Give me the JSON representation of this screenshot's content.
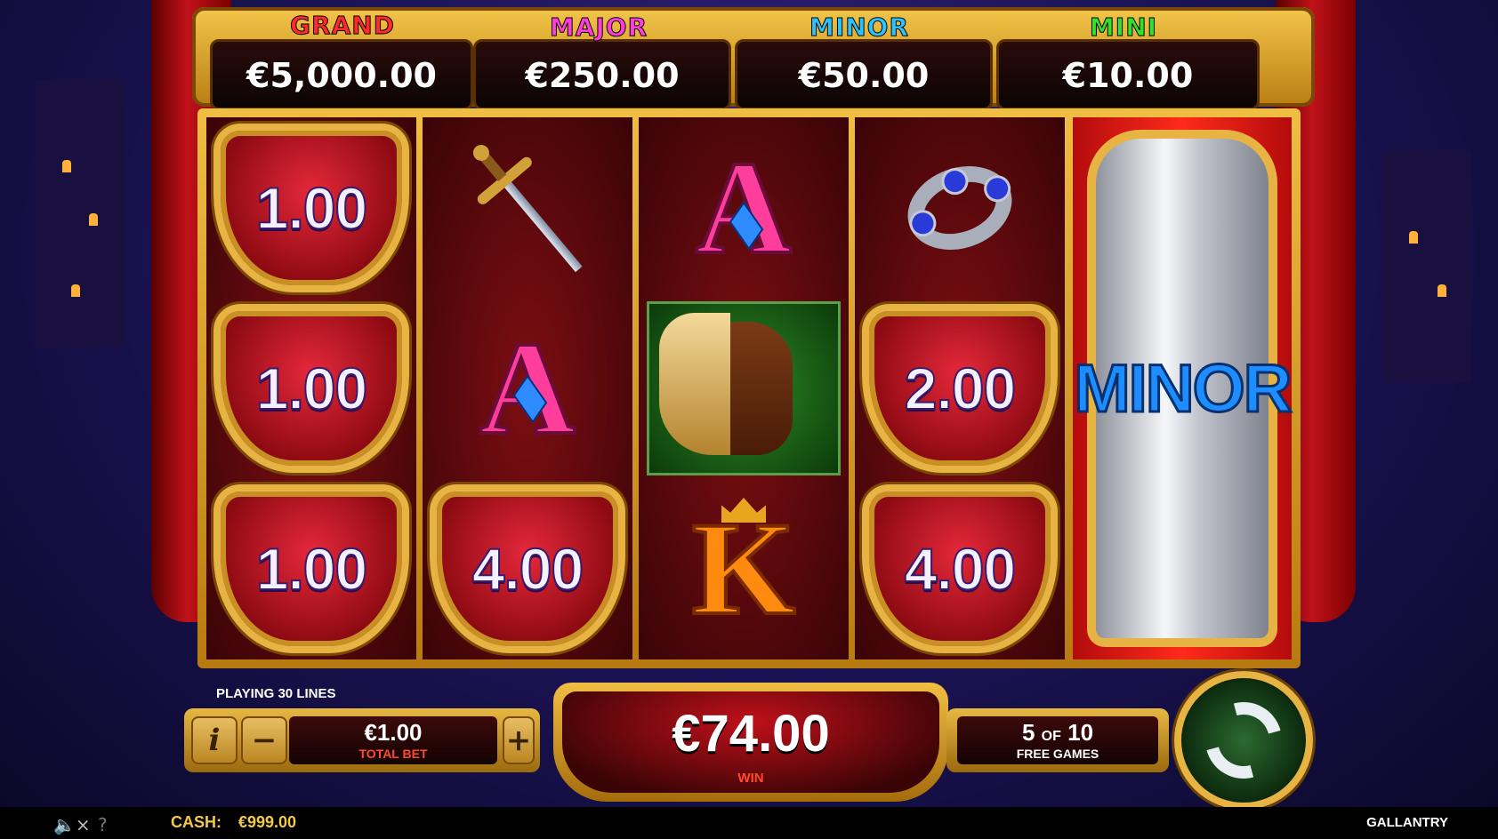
{
  "jackpots": [
    {
      "name": "GRAND",
      "value": "€5,000.00",
      "color": "#ff2a2a"
    },
    {
      "name": "MAJOR",
      "value": "€250.00",
      "color": "#ff3ddc"
    },
    {
      "name": "MINOR",
      "value": "€50.00",
      "color": "#2bc3ff"
    },
    {
      "name": "MINI",
      "value": "€10.00",
      "color": "#32e22a"
    }
  ],
  "reels": {
    "r1": [
      "1.00",
      "1.00",
      "1.00"
    ],
    "r2": {
      "top_icon": "sword-icon",
      "middle_letter": "A",
      "bottom_value": "4.00"
    },
    "r3": {
      "top_letter": "A",
      "middle_icon": "horse-icon",
      "bottom_letter": "K"
    },
    "r4": {
      "top_icon": "ring-icon",
      "middle_value": "2.00",
      "bottom_value": "4.00"
    },
    "r5": {
      "bonus_label": "MINOR"
    }
  },
  "controls": {
    "lines_label": "PLAYING 30 LINES",
    "info_label": "i",
    "minus_label": "−",
    "plus_label": "+",
    "bet_value": "€1.00",
    "bet_caption": "TOTAL BET",
    "win_value": "€74.00",
    "win_caption": "WIN",
    "free_current": "5",
    "free_of": "OF",
    "free_total": "10",
    "free_caption": "FREE GAMES"
  },
  "status": {
    "mute_icon": "🔈×",
    "help_icon": "?",
    "cash_label": "CASH:",
    "cash_value": "€999.00",
    "game_name": "GALLANTRY"
  },
  "colors": {
    "gold": "#e7b342",
    "reel_red": "#7d0e12",
    "minor_blue": "#1d8dff"
  }
}
